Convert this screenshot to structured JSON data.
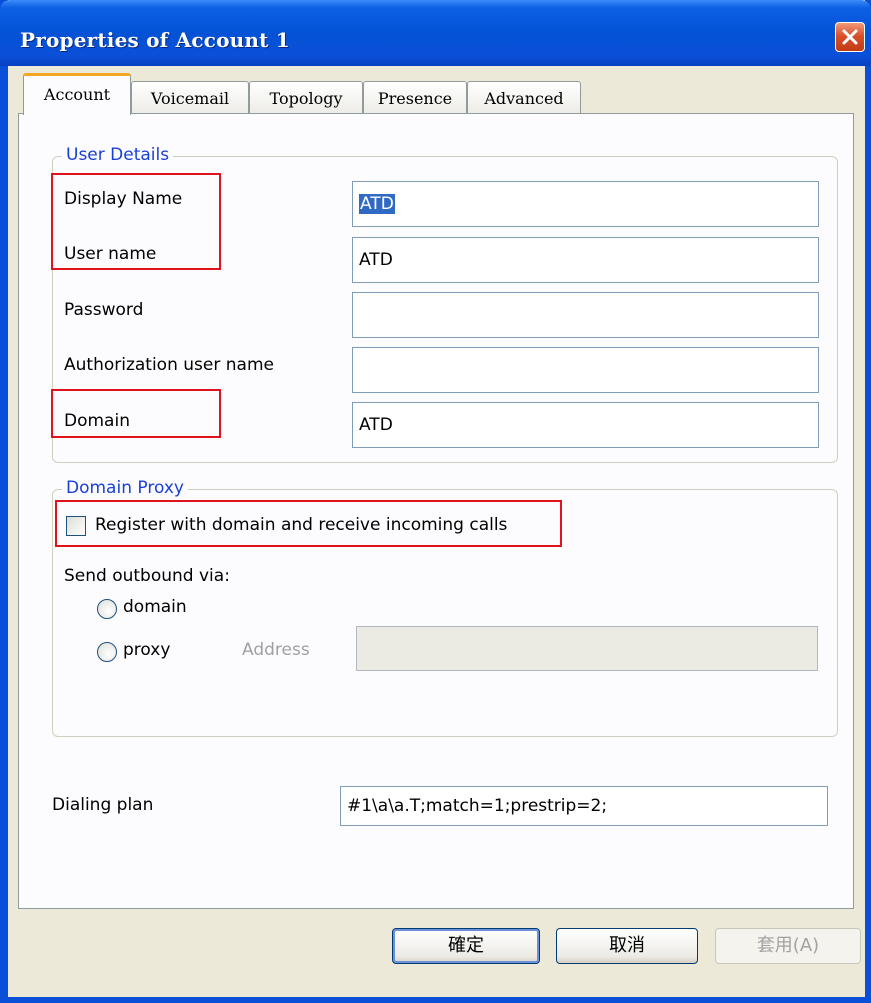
{
  "window": {
    "title": "Properties of Account 1",
    "close_icon": "close-icon"
  },
  "tabs": [
    {
      "label": "Account",
      "active": true
    },
    {
      "label": "Voicemail",
      "active": false
    },
    {
      "label": "Topology",
      "active": false
    },
    {
      "label": "Presence",
      "active": false
    },
    {
      "label": "Advanced",
      "active": false
    }
  ],
  "user_details": {
    "group_label": "User Details",
    "display_name": {
      "label": "Display Name",
      "value": "ATD"
    },
    "user_name": {
      "label": "User name",
      "value": "ATD"
    },
    "password": {
      "label": "Password",
      "value": ""
    },
    "auth_user_name": {
      "label": "Authorization user name",
      "value": ""
    },
    "domain": {
      "label": "Domain",
      "value": "ATD"
    }
  },
  "domain_proxy": {
    "group_label": "Domain Proxy",
    "register_checkbox": {
      "label": "Register with domain and receive incoming calls",
      "checked": false
    },
    "send_outbound_label": "Send outbound via:",
    "radio_domain": {
      "label": "domain",
      "selected": false
    },
    "radio_proxy": {
      "label": "proxy",
      "selected": false
    },
    "address": {
      "label": "Address",
      "value": ""
    }
  },
  "dialing_plan": {
    "label": "Dialing plan",
    "value": "#1\\a\\a.T;match=1;prestrip=2;"
  },
  "buttons": {
    "ok": "確定",
    "cancel": "取消",
    "apply": "套用(A)"
  },
  "colors": {
    "accent": "#0a4fd8",
    "highlight_box": "#e0121e",
    "group_label": "#1a3fd6",
    "active_tab": "#f5a623"
  }
}
